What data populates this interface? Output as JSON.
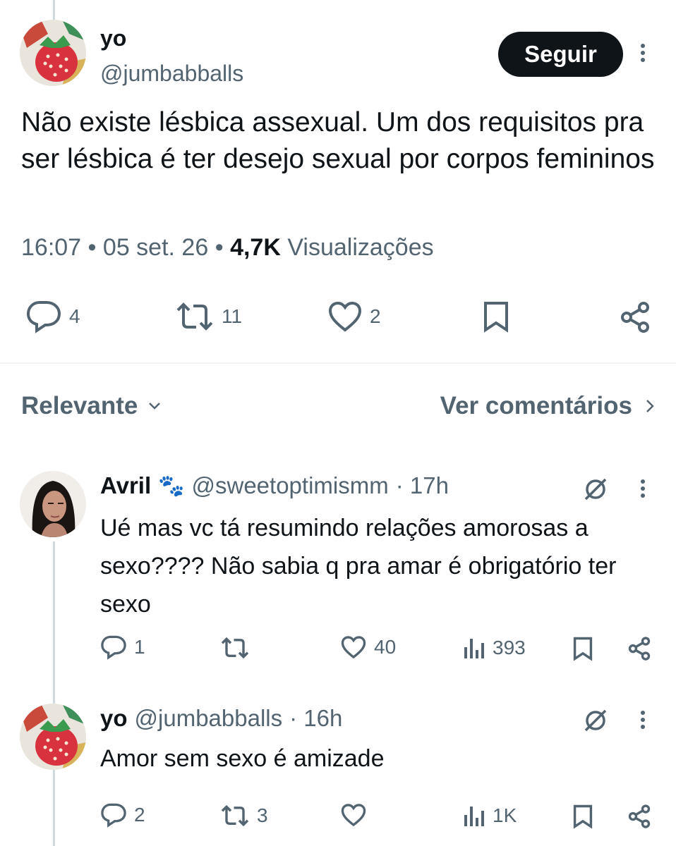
{
  "main_post": {
    "name": "yo",
    "handle": "@jumbabballs",
    "follow_label": "Seguir",
    "text": "Não existe lésbica assexual. Um dos requisitos pra ser lésbica é ter desejo sexual por corpos femininos",
    "time": "16:07",
    "date": "05 set. 26",
    "views_count": "4,7K",
    "views_label": "Visualizações",
    "replies": "4",
    "reposts": "11",
    "likes": "2"
  },
  "sort_bar": {
    "sort_label": "Relevante",
    "see_comments_label": "Ver comentários"
  },
  "replies": [
    {
      "name": "Avril",
      "emoji": "🐾",
      "handle": "@sweetoptimismm",
      "time": "· 17h",
      "text": "Ué mas vc tá resumindo relações amorosas a sexo???? Não sabia q pra amar é obrigatório ter sexo",
      "replies": "1",
      "reposts": "",
      "likes": "40",
      "views": "393"
    },
    {
      "name": "yo",
      "handle": "@jumbabballs",
      "time": "· 16h",
      "text": "Amor sem sexo é amizade",
      "replies": "2",
      "reposts": "3",
      "likes": "",
      "views": "1K"
    }
  ],
  "colors": {
    "text": "#0f1419",
    "secondary": "#536471",
    "line": "#cfd9de",
    "button": "#0f1419"
  }
}
